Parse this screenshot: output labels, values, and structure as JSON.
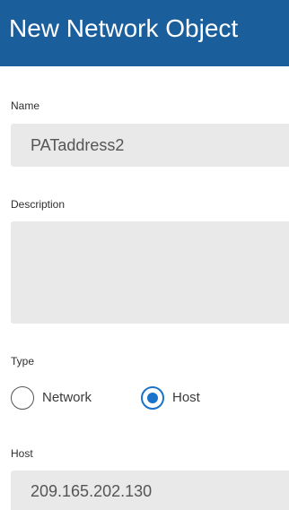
{
  "dialog": {
    "title": "New Network Object"
  },
  "name": {
    "label": "Name",
    "value": "PATaddress2"
  },
  "description": {
    "label": "Description",
    "value": ""
  },
  "type": {
    "label": "Type",
    "options": [
      {
        "label": "Network",
        "selected": false
      },
      {
        "label": "Host",
        "selected": true
      }
    ]
  },
  "host": {
    "label": "Host",
    "value": "209.165.202.130"
  },
  "colors": {
    "header": "#1a5e9c",
    "accent": "#1a73c8",
    "field": "#e9e9e9"
  }
}
